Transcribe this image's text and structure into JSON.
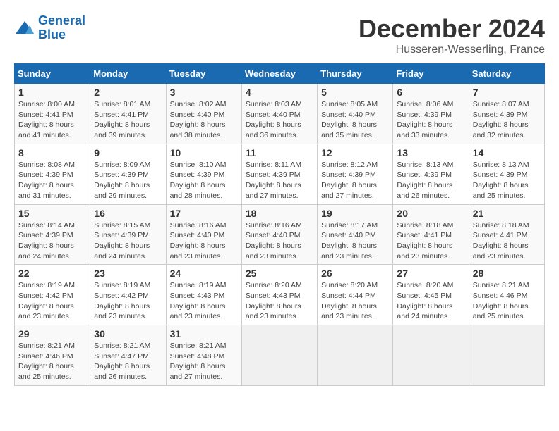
{
  "logo": {
    "line1": "General",
    "line2": "Blue"
  },
  "title": "December 2024",
  "subtitle": "Husseren-Wesserling, France",
  "days_of_week": [
    "Sunday",
    "Monday",
    "Tuesday",
    "Wednesday",
    "Thursday",
    "Friday",
    "Saturday"
  ],
  "weeks": [
    [
      {
        "day": 1,
        "info": "Sunrise: 8:00 AM\nSunset: 4:41 PM\nDaylight: 8 hours\nand 41 minutes."
      },
      {
        "day": 2,
        "info": "Sunrise: 8:01 AM\nSunset: 4:41 PM\nDaylight: 8 hours\nand 39 minutes."
      },
      {
        "day": 3,
        "info": "Sunrise: 8:02 AM\nSunset: 4:40 PM\nDaylight: 8 hours\nand 38 minutes."
      },
      {
        "day": 4,
        "info": "Sunrise: 8:03 AM\nSunset: 4:40 PM\nDaylight: 8 hours\nand 36 minutes."
      },
      {
        "day": 5,
        "info": "Sunrise: 8:05 AM\nSunset: 4:40 PM\nDaylight: 8 hours\nand 35 minutes."
      },
      {
        "day": 6,
        "info": "Sunrise: 8:06 AM\nSunset: 4:39 PM\nDaylight: 8 hours\nand 33 minutes."
      },
      {
        "day": 7,
        "info": "Sunrise: 8:07 AM\nSunset: 4:39 PM\nDaylight: 8 hours\nand 32 minutes."
      }
    ],
    [
      {
        "day": 8,
        "info": "Sunrise: 8:08 AM\nSunset: 4:39 PM\nDaylight: 8 hours\nand 31 minutes."
      },
      {
        "day": 9,
        "info": "Sunrise: 8:09 AM\nSunset: 4:39 PM\nDaylight: 8 hours\nand 29 minutes."
      },
      {
        "day": 10,
        "info": "Sunrise: 8:10 AM\nSunset: 4:39 PM\nDaylight: 8 hours\nand 28 minutes."
      },
      {
        "day": 11,
        "info": "Sunrise: 8:11 AM\nSunset: 4:39 PM\nDaylight: 8 hours\nand 27 minutes."
      },
      {
        "day": 12,
        "info": "Sunrise: 8:12 AM\nSunset: 4:39 PM\nDaylight: 8 hours\nand 27 minutes."
      },
      {
        "day": 13,
        "info": "Sunrise: 8:13 AM\nSunset: 4:39 PM\nDaylight: 8 hours\nand 26 minutes."
      },
      {
        "day": 14,
        "info": "Sunrise: 8:13 AM\nSunset: 4:39 PM\nDaylight: 8 hours\nand 25 minutes."
      }
    ],
    [
      {
        "day": 15,
        "info": "Sunrise: 8:14 AM\nSunset: 4:39 PM\nDaylight: 8 hours\nand 24 minutes."
      },
      {
        "day": 16,
        "info": "Sunrise: 8:15 AM\nSunset: 4:39 PM\nDaylight: 8 hours\nand 24 minutes."
      },
      {
        "day": 17,
        "info": "Sunrise: 8:16 AM\nSunset: 4:40 PM\nDaylight: 8 hours\nand 23 minutes."
      },
      {
        "day": 18,
        "info": "Sunrise: 8:16 AM\nSunset: 4:40 PM\nDaylight: 8 hours\nand 23 minutes."
      },
      {
        "day": 19,
        "info": "Sunrise: 8:17 AM\nSunset: 4:40 PM\nDaylight: 8 hours\nand 23 minutes."
      },
      {
        "day": 20,
        "info": "Sunrise: 8:18 AM\nSunset: 4:41 PM\nDaylight: 8 hours\nand 23 minutes."
      },
      {
        "day": 21,
        "info": "Sunrise: 8:18 AM\nSunset: 4:41 PM\nDaylight: 8 hours\nand 23 minutes."
      }
    ],
    [
      {
        "day": 22,
        "info": "Sunrise: 8:19 AM\nSunset: 4:42 PM\nDaylight: 8 hours\nand 23 minutes."
      },
      {
        "day": 23,
        "info": "Sunrise: 8:19 AM\nSunset: 4:42 PM\nDaylight: 8 hours\nand 23 minutes."
      },
      {
        "day": 24,
        "info": "Sunrise: 8:19 AM\nSunset: 4:43 PM\nDaylight: 8 hours\nand 23 minutes."
      },
      {
        "day": 25,
        "info": "Sunrise: 8:20 AM\nSunset: 4:43 PM\nDaylight: 8 hours\nand 23 minutes."
      },
      {
        "day": 26,
        "info": "Sunrise: 8:20 AM\nSunset: 4:44 PM\nDaylight: 8 hours\nand 23 minutes."
      },
      {
        "day": 27,
        "info": "Sunrise: 8:20 AM\nSunset: 4:45 PM\nDaylight: 8 hours\nand 24 minutes."
      },
      {
        "day": 28,
        "info": "Sunrise: 8:21 AM\nSunset: 4:46 PM\nDaylight: 8 hours\nand 25 minutes."
      }
    ],
    [
      {
        "day": 29,
        "info": "Sunrise: 8:21 AM\nSunset: 4:46 PM\nDaylight: 8 hours\nand 25 minutes."
      },
      {
        "day": 30,
        "info": "Sunrise: 8:21 AM\nSunset: 4:47 PM\nDaylight: 8 hours\nand 26 minutes."
      },
      {
        "day": 31,
        "info": "Sunrise: 8:21 AM\nSunset: 4:48 PM\nDaylight: 8 hours\nand 27 minutes."
      },
      null,
      null,
      null,
      null
    ]
  ]
}
